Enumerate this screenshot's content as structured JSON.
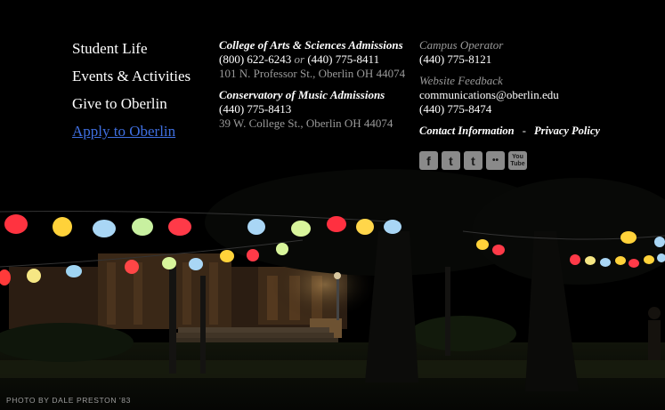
{
  "nav": {
    "items": [
      {
        "label": "Student Life"
      },
      {
        "label": "Events & Activities"
      },
      {
        "label": "Give to Oberlin"
      },
      {
        "label": "Apply to Oberlin"
      }
    ]
  },
  "admissions": {
    "arts": {
      "heading": "College of Arts & Sciences Admissions",
      "phone1": "(800) 622-6243",
      "or": "or",
      "phone2": "(440) 775-8411",
      "address": "101 N. Professor St., Oberlin OH 44074"
    },
    "conservatory": {
      "heading": "Conservatory of Music Admissions",
      "phone": "(440) 775-8413",
      "address": "39 W. College St., Oberlin OH 44074"
    }
  },
  "contact": {
    "operator_label": "Campus Operator",
    "operator_phone": "(440) 775-8121",
    "feedback_label": "Website Feedback",
    "feedback_email": "communications@oberlin.edu",
    "feedback_phone": "(440) 775-8474",
    "contact_info_link": "Contact Information",
    "separator": "-",
    "privacy_link": "Privacy Policy"
  },
  "social": [
    {
      "icon": "facebook-icon",
      "glyph": "f"
    },
    {
      "icon": "twitter-icon",
      "glyph": "t"
    },
    {
      "icon": "tumblr-icon",
      "glyph": "t"
    },
    {
      "icon": "flickr-icon",
      "glyph": "••"
    },
    {
      "icon": "youtube-icon",
      "glyph": "You Tube"
    }
  ],
  "photo_credit": "PHOTO BY DALE PRESTON '83",
  "colors": {
    "link_active": "#3f6fe0",
    "muted": "#9a9a9a"
  }
}
